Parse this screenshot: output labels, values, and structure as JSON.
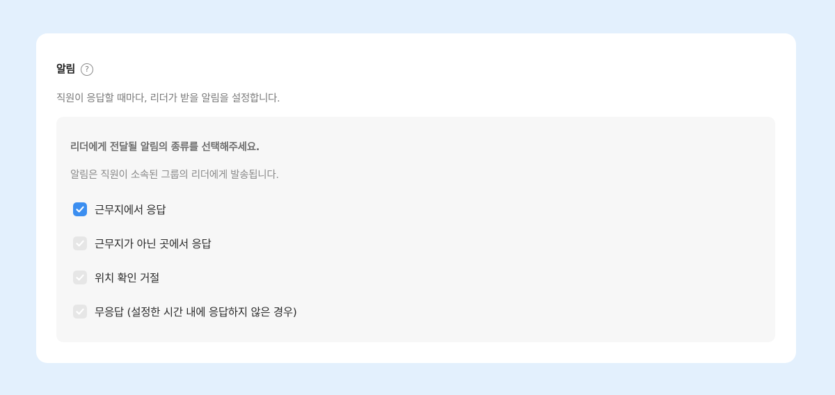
{
  "section": {
    "title": "알림",
    "help_icon": "question-circle-icon",
    "description": "직원이 응답할 때마다, 리더가 받을 알림을 설정합니다."
  },
  "panel": {
    "heading": "리더에게 전달될 알림의 종류를 선택해주세요.",
    "subtext": "알림은 직원이 소속된 그룹의 리더에게 발송됩니다.",
    "options": [
      {
        "label": "근무지에서 응답",
        "checked": true
      },
      {
        "label": "근무지가 아닌 곳에서 응답",
        "checked": false
      },
      {
        "label": "위치 확인 거절",
        "checked": false
      },
      {
        "label": "무응답 (설정한 시간 내에 응답하지 않은 경우)",
        "checked": false
      }
    ]
  },
  "colors": {
    "background": "#e3f0fd",
    "card": "#ffffff",
    "panel": "#f7f7f7",
    "accent": "#3b8ef0",
    "checkbox_unchecked": "#e6e6e6"
  }
}
